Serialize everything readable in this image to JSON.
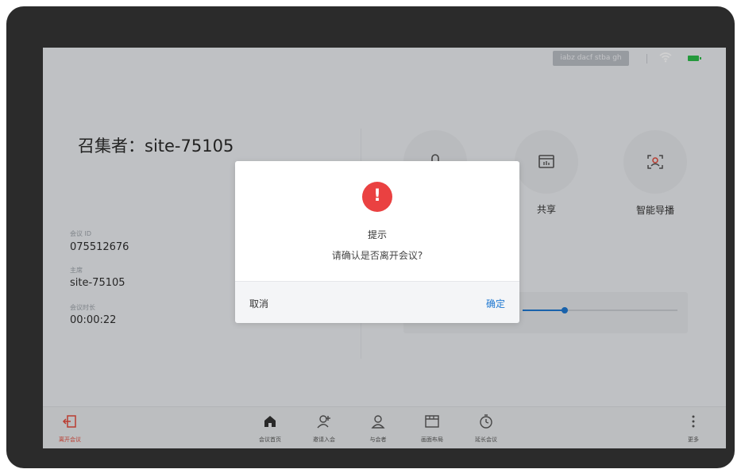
{
  "status": {
    "network_label": "iabz dacf stba gh"
  },
  "conference": {
    "convener_line": "召集者：site-75105",
    "info": [
      {
        "label": "会议 ID",
        "value": "075512676"
      },
      {
        "label": "主席",
        "value": "site-75105"
      },
      {
        "label": "会议时长",
        "value": "00:00:22"
      }
    ]
  },
  "quick_actions": [
    {
      "name": "microphone",
      "label": "",
      "icon": "microphone-icon"
    },
    {
      "name": "share",
      "label": "共享",
      "icon": "share-screen-icon"
    },
    {
      "name": "smart-director",
      "label": "智能导播",
      "icon": "face-frame-icon"
    }
  ],
  "volume": {
    "level": 0.27
  },
  "bottom_tabs": [
    {
      "label": "离开会议",
      "icon": "exit-icon"
    },
    {
      "label": "会议首页",
      "icon": "home-icon"
    },
    {
      "label": "邀请入会",
      "icon": "invite-user-icon"
    },
    {
      "label": "与会者",
      "icon": "participants-icon"
    },
    {
      "label": "画面布局",
      "icon": "layout-icon"
    },
    {
      "label": "延长会议",
      "icon": "timer-icon"
    },
    {
      "label": "更多",
      "icon": "more-icon"
    }
  ],
  "dialog": {
    "icon": "!",
    "title": "提示",
    "message": "请确认是否离开会议?",
    "cancel": "取消",
    "confirm": "确定"
  },
  "colors": {
    "accent": "#1f78d1",
    "danger": "#ea4141",
    "battery": "#2dbb4a"
  }
}
